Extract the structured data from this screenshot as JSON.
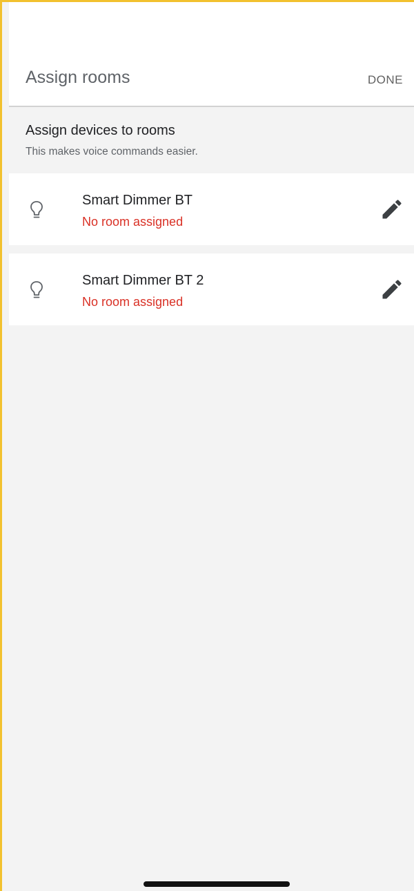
{
  "header": {
    "title": "Assign rooms",
    "done_label": "DONE"
  },
  "section": {
    "title": "Assign devices to rooms",
    "subtitle": "This makes voice commands easier."
  },
  "devices": [
    {
      "name": "Smart Dimmer BT",
      "status": "No room assigned",
      "icon": "lightbulb-icon"
    },
    {
      "name": "Smart Dimmer BT 2",
      "status": "No room assigned",
      "icon": "lightbulb-icon"
    }
  ],
  "colors": {
    "accent_border": "#f2c12e",
    "status_error": "#d93025",
    "background": "#f3f3f3"
  }
}
